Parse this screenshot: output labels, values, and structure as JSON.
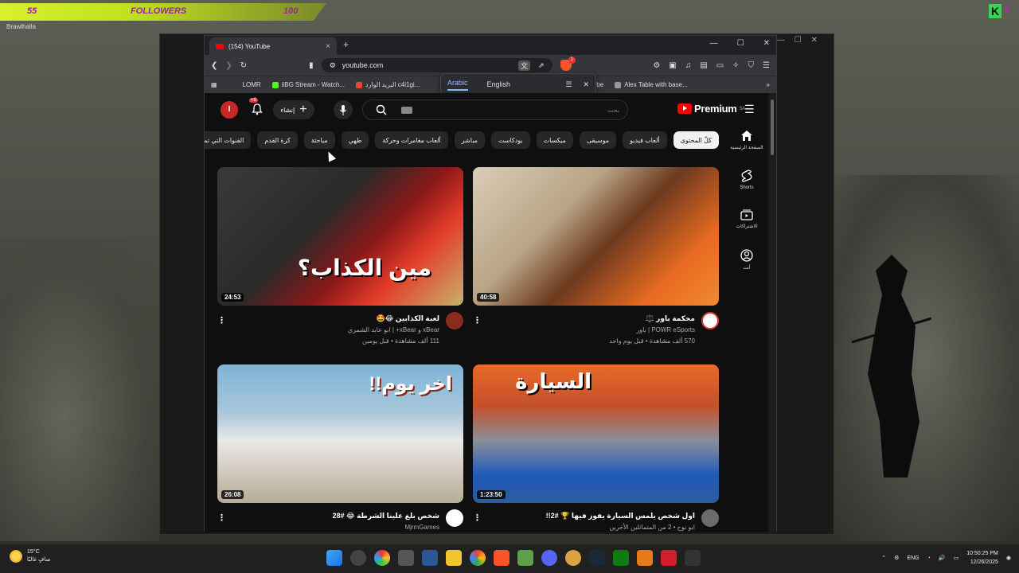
{
  "overlay": {
    "left_value": "55",
    "center_label": "FOLLOWERS",
    "right_value": "100",
    "game_label": "Brawlhalla"
  },
  "browser": {
    "tab_title": "(154) YouTube",
    "new_tab": "+",
    "close_tab": "×",
    "window_min": "—",
    "window_max": "☐",
    "window_close": "✕",
    "url": "youtube.com",
    "brave_badge": "1",
    "bookmarks": [
      {
        "label": "LOMR"
      },
      {
        "label": "iiBG Stream - Watch..."
      },
      {
        "label": "البريد الوارد c4i1gi..."
      },
      {
        "label": "ouTube"
      },
      {
        "label": "Alex Table with base..."
      }
    ],
    "bookmarks_more": "»",
    "translate": {
      "lang_from": "Arabic",
      "lang_to": "English"
    }
  },
  "youtube": {
    "avatar_letter": "I",
    "notifications_badge": "+9",
    "create_label": "إنشاء",
    "search_placeholder": "بحث",
    "logo_text": "Premium",
    "logo_region": "SA",
    "chips": [
      "كلّ المحتوى",
      "ألعاب فيديو",
      "موسيقى",
      "ميكسات",
      "بودكاست",
      "مباشر",
      "ألعاب مغامرات وحركة",
      "ألعاب مغامرات وحركة",
      "طهي",
      "مباحثة",
      "كرة القدم",
      "الفنوات التي تم تحميلها مؤخرًا"
    ],
    "sidebar": [
      {
        "label": "الصفحة الرئيسية",
        "icon": "home-icon"
      },
      {
        "label": "Shorts",
        "icon": "shorts-icon"
      },
      {
        "label": "الاشتراكات",
        "icon": "subscriptions-icon"
      },
      {
        "label": "أنت",
        "icon": "you-icon"
      }
    ],
    "videos": [
      {
        "title": "محكمة باور ⚖️",
        "channel": "POWR eSports | باور",
        "stats": "570 ألف مشاهدة • قبل يوم واحد",
        "duration": "40:58",
        "thumb_text": ""
      },
      {
        "title": "لعبة الكذابين 😂🤩",
        "channel": "xBear و xBear+ | ابو عابد الشمري",
        "stats": "111 ألف مشاهدة • قبل يومين",
        "duration": "24:53",
        "thumb_text": "مين الكذاب؟"
      },
      {
        "title": "اول شخص يلمس السيارة يفوز فيها 🏆 #2!!",
        "channel": "ابو نوح • 2 من المتماثلين الأخرين",
        "stats": "",
        "duration": "1:23:50",
        "thumb_text": "السيارة"
      },
      {
        "title": "شخص بلغ علينا الشرطة 😂 #28",
        "channel": "MjrmGames",
        "stats": "",
        "duration": "26:08",
        "thumb_text": "اخر يوم!!"
      }
    ]
  },
  "taskbar": {
    "temp": "15°C",
    "weather": "صافٍ غالبًا",
    "lang": "ENG",
    "time": "10:50:25 PM",
    "date": "12/26/2025"
  }
}
